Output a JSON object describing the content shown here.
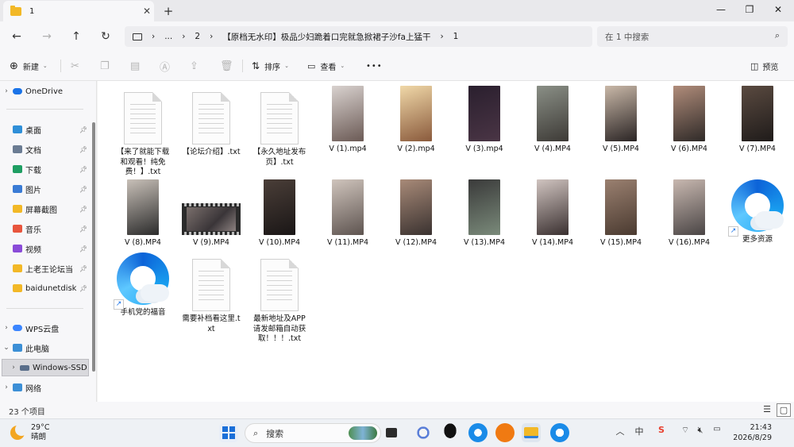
{
  "window": {
    "tab_title": "1",
    "new_tab": "+",
    "minimize": "—",
    "maximize": "❐",
    "close": "✕"
  },
  "nav": {
    "back": "←",
    "forward": "→",
    "up": "↑",
    "refresh": "↻",
    "breadcrumb": [
      "...",
      "2",
      "【原档无水印】极品少妇跪着口完就急掀裙子沙fa上猛干",
      "1"
    ],
    "search_placeholder": "在 1 中搜索"
  },
  "toolbar": {
    "new": "新建",
    "sort": "排序",
    "view": "查看",
    "more": "•••",
    "preview": "预览"
  },
  "sidebar": {
    "onedrive": "OneDrive",
    "quick": [
      {
        "label": "桌面",
        "color": "#2f8fd8"
      },
      {
        "label": "文档",
        "color": "#6b7c93"
      },
      {
        "label": "下载",
        "color": "#1f9e63"
      },
      {
        "label": "图片",
        "color": "#3a7bd5"
      },
      {
        "label": "屏幕截图",
        "color": "#f2b827"
      },
      {
        "label": "音乐",
        "color": "#e8553d"
      },
      {
        "label": "视频",
        "color": "#8a4bd8"
      },
      {
        "label": "上老王论坛当",
        "color": "#f2b827"
      },
      {
        "label": "baidunetdisk",
        "color": "#f2b827"
      }
    ],
    "wps": "WPS云盘",
    "this_pc": "此电脑",
    "drive": "Windows-SSD",
    "network": "网络"
  },
  "files": [
    {
      "name": "【来了就能下载和观看！纯免费！】.txt",
      "kind": "txt"
    },
    {
      "name": "【论坛介绍】.txt",
      "kind": "txt"
    },
    {
      "name": "【永久地址发布页】.txt",
      "kind": "txt"
    },
    {
      "name": "V (1).mp4",
      "kind": "video",
      "c1": "#d9d2cf",
      "c2": "#6b5a55"
    },
    {
      "name": "V (2).mp4",
      "kind": "video",
      "c1": "#f0d8a8",
      "c2": "#8a5a3c"
    },
    {
      "name": "V (3).mp4",
      "kind": "video",
      "c1": "#2a1f2e",
      "c2": "#4a3545"
    },
    {
      "name": "V (4).MP4",
      "kind": "video",
      "c1": "#8a8f86",
      "c2": "#3d3a36"
    },
    {
      "name": "V (5).MP4",
      "kind": "video",
      "c1": "#c9b8a8",
      "c2": "#2a2424"
    },
    {
      "name": "V (6).MP4",
      "kind": "video",
      "c1": "#b08c7a",
      "c2": "#2f2a28"
    },
    {
      "name": "V (7).MP4",
      "kind": "video",
      "c1": "#5a4a40",
      "c2": "#1f1b1a"
    },
    {
      "name": "V (8).MP4",
      "kind": "video",
      "c1": "#c8c0b8",
      "c2": "#2b2b2b"
    },
    {
      "name": "V (9).MP4",
      "kind": "wide"
    },
    {
      "name": "V (10).MP4",
      "kind": "video",
      "c1": "#4a3e38",
      "c2": "#1a1616"
    },
    {
      "name": "V (11).MP4",
      "kind": "video",
      "c1": "#cfc4bc",
      "c2": "#5e5450"
    },
    {
      "name": "V (12).MP4",
      "kind": "video",
      "c1": "#a88a78",
      "c2": "#3a3230"
    },
    {
      "name": "V (13).MP4",
      "kind": "video",
      "c1": "#3a3a3a",
      "c2": "#7a8a7a"
    },
    {
      "name": "V (14).MP4",
      "kind": "video",
      "c1": "#d0c4c0",
      "c2": "#3a3030"
    },
    {
      "name": "V (15).MP4",
      "kind": "video",
      "c1": "#9a8070",
      "c2": "#4a3a30"
    },
    {
      "name": "V (16).MP4",
      "kind": "video",
      "c1": "#c8b8b0",
      "c2": "#4a4545"
    },
    {
      "name": "更多资源",
      "kind": "shortcut"
    },
    {
      "name": "手机党的福音",
      "kind": "shortcut"
    },
    {
      "name": "需要补档看这里.txt",
      "kind": "txt"
    },
    {
      "name": "最新地址及APP请发邮箱自动获取！！！.txt",
      "kind": "txt"
    }
  ],
  "status": {
    "item_count": "23 个项目"
  },
  "taskbar": {
    "temperature": "29°C",
    "weather": "晴朗",
    "search_label": "搜索",
    "ime": "中",
    "time": "21:43",
    "date": "2026/8/29"
  }
}
